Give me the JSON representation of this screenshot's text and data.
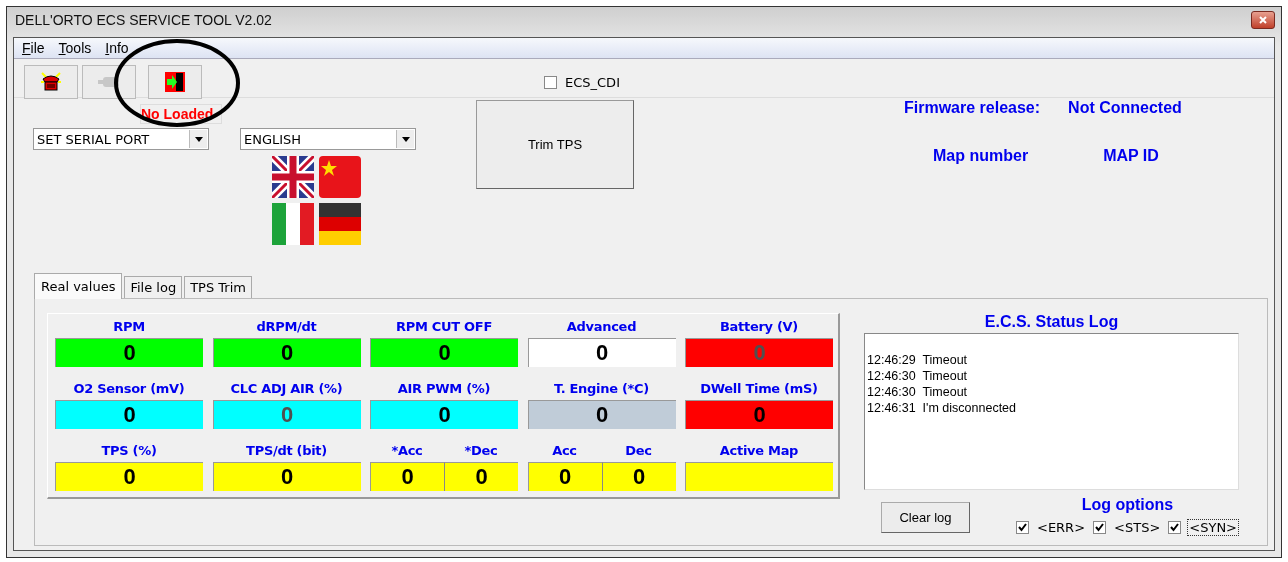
{
  "window": {
    "title": "DELL'ORTO ECS SERVICE TOOL  V2.02"
  },
  "menu": [
    {
      "label": "File"
    },
    {
      "label": "Tools"
    },
    {
      "label": "Info"
    }
  ],
  "toolbar": [
    {
      "kind": "phone",
      "disabled": false
    },
    {
      "kind": "plug",
      "disabled": true
    },
    {
      "kind": "load",
      "disabled": false
    }
  ],
  "load_status": "No Loaded",
  "ecs_cdi": {
    "label": "ECS_CDI",
    "checked": false
  },
  "serial_port": {
    "value": "SET SERIAL PORT"
  },
  "language": {
    "value": "ENGLISH"
  },
  "flags": [
    {
      "kind": "uk"
    },
    {
      "kind": "china"
    },
    {
      "kind": "italy"
    },
    {
      "kind": "germany"
    }
  ],
  "trim_button": "Trim TPS",
  "info": [
    {
      "label": "Firmware release:",
      "value": "Not Connected"
    },
    {
      "label": "Map number",
      "value": "MAP ID"
    }
  ],
  "tabs": [
    {
      "label": "Real values",
      "selected": true
    },
    {
      "label": "File log",
      "selected": false
    },
    {
      "label": "TPS Trim",
      "selected": false
    }
  ],
  "values": [
    {
      "kind": "single",
      "label": "RPM",
      "value": "0",
      "color": "#00ff00",
      "dimmed": false
    },
    {
      "kind": "single",
      "label": "dRPM/dt",
      "value": "0",
      "color": "#00ff00",
      "dimmed": false
    },
    {
      "kind": "single",
      "label": "RPM CUT OFF",
      "value": "0",
      "color": "#00ff00",
      "dimmed": false
    },
    {
      "kind": "single",
      "label": "Advanced",
      "value": "0",
      "color": "#ffffff",
      "dimmed": false
    },
    {
      "kind": "single",
      "label": "Battery (V)",
      "value": "0",
      "color": "#ff0000",
      "dimmed": true
    },
    {
      "kind": "single",
      "label": "O2 Sensor (mV)",
      "value": "0",
      "color": "#00ffff",
      "dimmed": false
    },
    {
      "kind": "single",
      "label": "CLC ADJ AIR (%)",
      "value": "0",
      "color": "#00ffff",
      "dimmed": true
    },
    {
      "kind": "single",
      "label": "AIR PWM (%)",
      "value": "0",
      "color": "#00ffff",
      "dimmed": false
    },
    {
      "kind": "single",
      "label": "T. Engine (*C)",
      "value": "0",
      "color": "#c0ccd8",
      "dimmed": false
    },
    {
      "kind": "single",
      "label": "DWell Time (mS)",
      "value": "0",
      "color": "#ff0000",
      "dimmed": false
    },
    {
      "kind": "single",
      "label": "TPS (%)",
      "value": "0",
      "color": "#ffff00",
      "dimmed": false
    },
    {
      "kind": "single",
      "label": "TPS/dt (bit)",
      "value": "0",
      "color": "#ffff00",
      "dimmed": false
    },
    {
      "kind": "pair",
      "color": "#ffff00",
      "parts": [
        {
          "label": "*Acc",
          "value": "0"
        },
        {
          "label": "*Dec",
          "value": "0"
        }
      ]
    },
    {
      "kind": "pair",
      "color": "#ffff00",
      "parts": [
        {
          "label": "Acc",
          "value": "0"
        },
        {
          "label": "Dec",
          "value": "0"
        }
      ]
    },
    {
      "kind": "single",
      "label": "Active Map",
      "color": "#ffff00"
    }
  ],
  "status_log": {
    "title": "E.C.S. Status Log",
    "lines": [
      "12:46:29  Timeout",
      "12:46:30  Timeout",
      "12:46:30  Timeout",
      "12:46:31  I'm disconnected"
    ],
    "clear_button": "Clear log"
  },
  "log_options": {
    "title": "Log options",
    "items": [
      {
        "label": "<ERR>",
        "checked": true,
        "focused": false
      },
      {
        "label": "<STS>",
        "checked": true,
        "focused": false
      },
      {
        "label": "<SYN>",
        "checked": true,
        "focused": true
      }
    ]
  }
}
